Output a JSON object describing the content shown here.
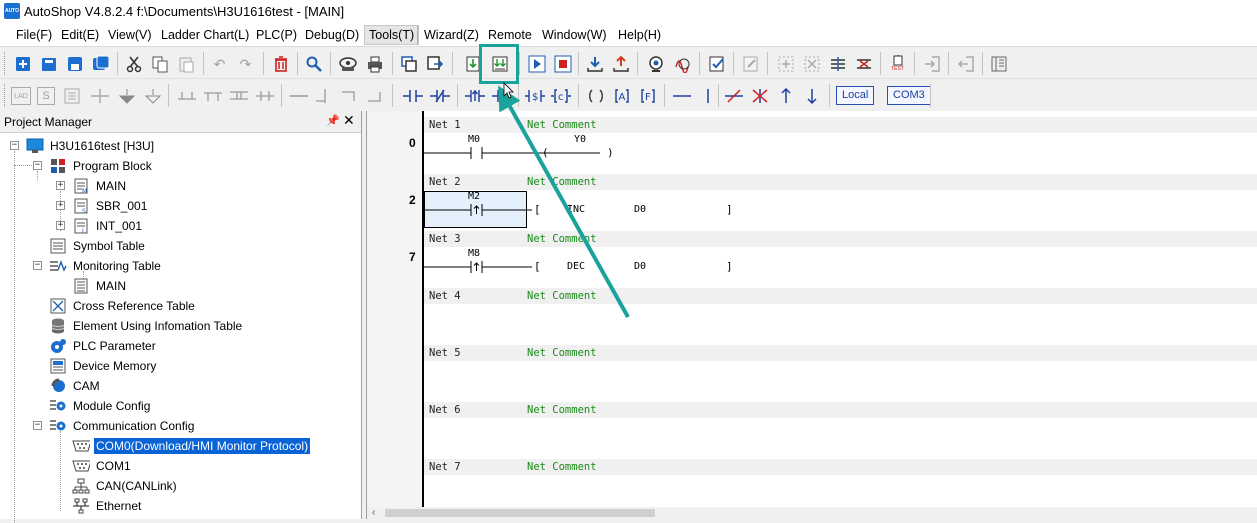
{
  "window": {
    "title": "AutoShop V4.8.2.4  f:\\Documents\\H3U1616test - [MAIN]",
    "app_icon_text": "AUTO",
    "accent_color": "#1aa39a"
  },
  "menu": {
    "file": "File(F)",
    "edit": "Edit(E)",
    "view": "View(V)",
    "ladder_chart": "Ladder Chart(L)",
    "plc": "PLC(P)",
    "debug": "Debug(D)",
    "tools": "Tools(T)",
    "wizard": "Wizard(Z)",
    "remote": "Remote",
    "window": "Window(W)",
    "help": "Help(H)"
  },
  "toolbar": {
    "local_label": "Local",
    "com_label": "COM3",
    "test_label": "TEST",
    "lad_label": "LAD",
    "s_label": "S"
  },
  "project_manager": {
    "title": "Project Manager",
    "pin_icon": "pin-icon",
    "close_icon": "close-icon",
    "items": [
      {
        "label": "H3U1616test [H3U]",
        "icon": "computer-icon"
      },
      {
        "label": "Program Block",
        "icon": "program-block-icon"
      },
      {
        "label": "MAIN",
        "icon": "main-program-icon"
      },
      {
        "label": "SBR_001",
        "icon": "subroutine-icon"
      },
      {
        "label": "INT_001",
        "icon": "interrupt-icon"
      },
      {
        "label": "Symbol Table",
        "icon": "symbol-table-icon"
      },
      {
        "label": "Monitoring Table",
        "icon": "monitoring-table-icon"
      },
      {
        "label": "MAIN",
        "icon": "monitor-main-icon"
      },
      {
        "label": "Cross Reference Table",
        "icon": "cross-reference-icon"
      },
      {
        "label": "Element Using Infomation Table",
        "icon": "database-icon"
      },
      {
        "label": "PLC Parameter",
        "icon": "plc-parameter-icon"
      },
      {
        "label": "Device Memory",
        "icon": "device-memory-icon"
      },
      {
        "label": "CAM",
        "icon": "cam-icon"
      },
      {
        "label": "Module Config",
        "icon": "module-config-icon"
      },
      {
        "label": "Communication Config",
        "icon": "communication-config-icon"
      },
      {
        "label": "COM0(Download/HMI Monitor Protocol)",
        "icon": "serial-port-icon"
      },
      {
        "label": "COM1",
        "icon": "serial-port-icon"
      },
      {
        "label": "CAN(CANLink)",
        "icon": "can-network-icon"
      },
      {
        "label": "Ethernet",
        "icon": "ethernet-icon"
      }
    ]
  },
  "ladder": {
    "networks": [
      {
        "label": "Net 1",
        "comment": "Net Comment",
        "step": "0",
        "contact": "M0",
        "instruction": "",
        "output": "Y0",
        "operand": "",
        "bracket_open": "(",
        "bracket_close": ")"
      },
      {
        "label": "Net 2",
        "comment": "Net Comment",
        "step": "2",
        "contact": "M2",
        "instruction": "INC",
        "output": "",
        "operand": "D0",
        "bracket_open": "[",
        "bracket_close": "]"
      },
      {
        "label": "Net 3",
        "comment": "Net Comment",
        "step": "7",
        "contact": "M8",
        "instruction": "DEC",
        "output": "",
        "operand": "D0",
        "bracket_open": "[",
        "bracket_close": "]"
      },
      {
        "label": "Net 4",
        "comment": "Net Comment"
      },
      {
        "label": "Net 5",
        "comment": "Net Comment"
      },
      {
        "label": "Net 6",
        "comment": "Net Comment"
      },
      {
        "label": "Net 7",
        "comment": "Net Comment"
      }
    ]
  }
}
